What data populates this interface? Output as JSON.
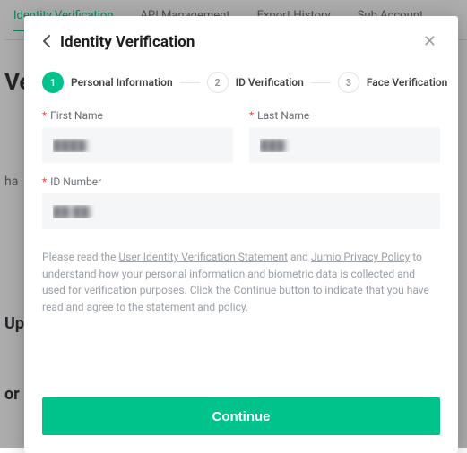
{
  "background": {
    "tabs": [
      "Identity Verification",
      "API Management",
      "Export History",
      "Sub Account"
    ],
    "active_tab_index": 0,
    "fragments": [
      "Ve",
      "ha",
      "Up",
      "or"
    ]
  },
  "modal": {
    "title": "Identity Verification",
    "steps": [
      {
        "num": "1",
        "label": "Personal Information",
        "active": true
      },
      {
        "num": "2",
        "label": "ID Verification",
        "active": false
      },
      {
        "num": "3",
        "label": "Face Verification",
        "active": false
      }
    ],
    "fields": {
      "first_name": {
        "label": "First Name",
        "value": "████",
        "required": true
      },
      "last_name": {
        "label": "Last Name",
        "value": "███",
        "required": true
      },
      "id_number": {
        "label": "ID Number",
        "value": "██ ██",
        "required": true
      }
    },
    "disclaimer": {
      "pre": "Please read the ",
      "link1": "User Identity Verification Statement",
      "mid": " and ",
      "link2": "Jumio Privacy Policy",
      "post": " to understand how your personal information and biometric data is collected and used for verification purposes. Click the Continue button to indicate that you have read and agree to the statement and policy."
    },
    "continue_label": "Continue"
  }
}
